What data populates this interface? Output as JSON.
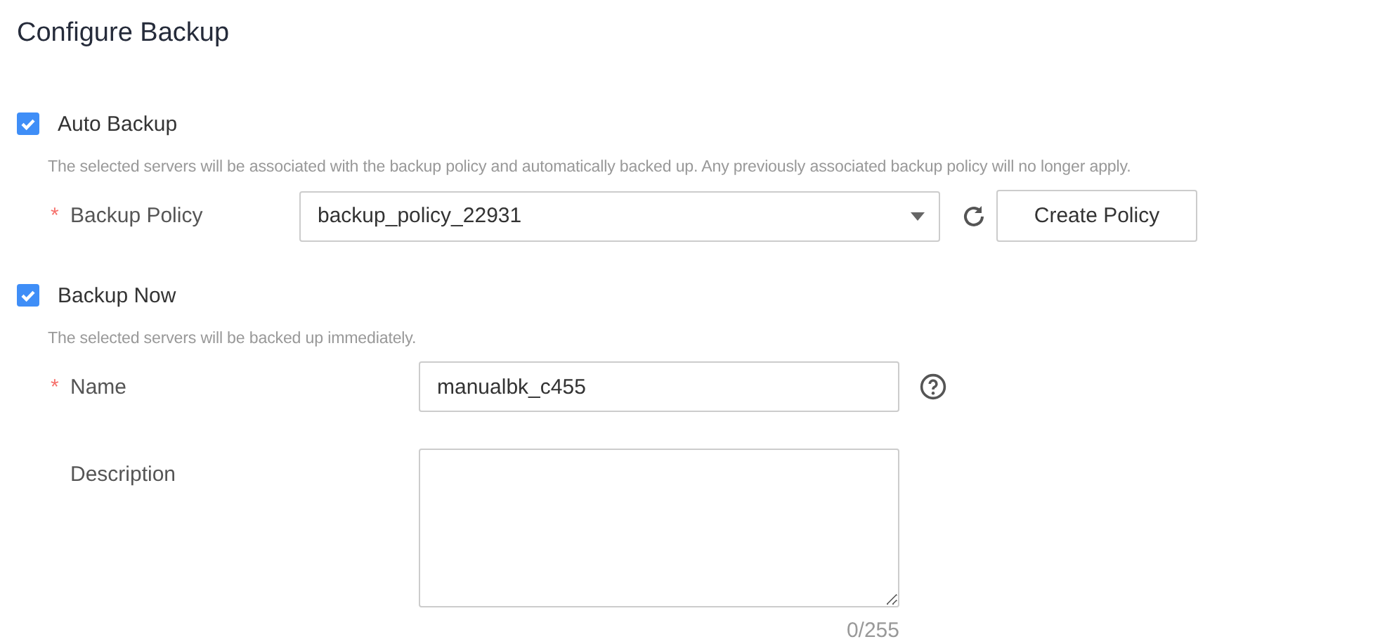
{
  "title": "Configure Backup",
  "sections": [
    {
      "label": "Auto Backup",
      "checked": true,
      "description": "The selected servers will be associated with the backup policy and automatically backed up. Any previously associated backup policy will no longer apply.",
      "kind": "policy",
      "fields": [
        {
          "kind": "select",
          "required_mark": "*",
          "label": "Backup Policy",
          "value": "backup_policy_22931",
          "refresh": true,
          "button": "Create Policy"
        }
      ]
    },
    {
      "label": "Backup Now",
      "checked": true,
      "description": "The selected servers will be backed up immediately.",
      "kind": "manual",
      "fields": [
        {
          "kind": "text",
          "required_mark": "*",
          "label": "Name",
          "value": "manualbk_c455",
          "help": true
        },
        {
          "kind": "textarea",
          "label": "Description",
          "counter": "0/255"
        }
      ]
    }
  ]
}
